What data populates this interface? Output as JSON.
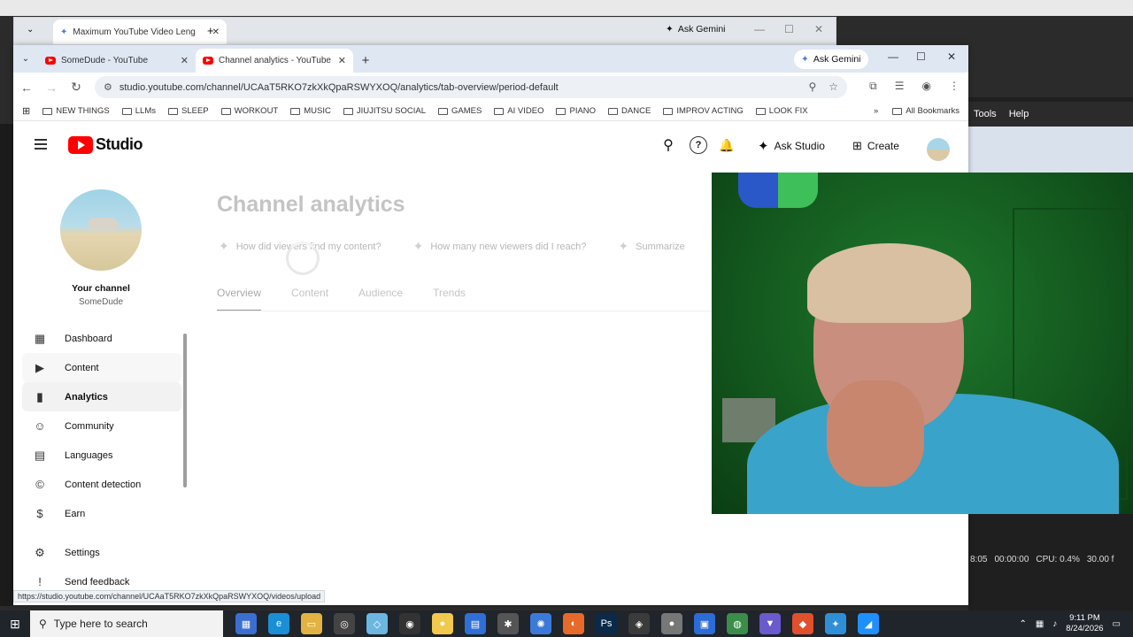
{
  "back_window": {
    "tab_title": "Maximum YouTube Video Leng",
    "gemini_label": "Ask Gemini"
  },
  "browser": {
    "tabs": [
      {
        "title": "SomeDude - YouTube",
        "active": false
      },
      {
        "title": "Channel analytics - YouTube St",
        "active": true
      }
    ],
    "gemini_label": "Ask Gemini",
    "url": "studio.youtube.com/channel/UCAaT5RKO7zkXkQpaRSWYXOQ/analytics/tab-overview/period-default",
    "bookmarks": [
      "NEW THINGS",
      "LLMs",
      "SLEEP",
      "WORKOUT",
      "MUSIC",
      "JIUJITSU SOCIAL",
      "GAMES",
      "AI VIDEO",
      "PIANO",
      "DANCE",
      "IMPROV ACTING",
      "LOOK FIX"
    ],
    "all_bookmarks": "All Bookmarks",
    "status_url": "https://studio.youtube.com/channel/UCAaT5RKO7zkXkQpaRSWYXOQ/videos/upload"
  },
  "studio": {
    "logo_text": "Studio",
    "ask_studio": "Ask Studio",
    "create": "Create",
    "channel": {
      "label": "Your channel",
      "name": "SomeDude"
    },
    "nav": [
      {
        "label": "Dashboard",
        "icon": "dashboard-icon"
      },
      {
        "label": "Content",
        "icon": "content-icon"
      },
      {
        "label": "Analytics",
        "icon": "analytics-icon"
      },
      {
        "label": "Community",
        "icon": "community-icon"
      },
      {
        "label": "Languages",
        "icon": "languages-icon"
      },
      {
        "label": "Content detection",
        "icon": "copyright-icon"
      },
      {
        "label": "Earn",
        "icon": "earn-icon"
      }
    ],
    "nav_bottom": [
      {
        "label": "Settings",
        "icon": "gear-icon"
      },
      {
        "label": "Send feedback",
        "icon": "feedback-icon"
      }
    ],
    "page_title": "Channel analytics",
    "chips": [
      "How did viewers find my content?",
      "How many new viewers did I reach?",
      "Summarize"
    ],
    "tabs": [
      "Overview",
      "Content",
      "Audience",
      "Trends"
    ]
  },
  "desktop_app": {
    "menu": [
      "Tools",
      "Help"
    ],
    "status": [
      "8:05",
      "00:00:00",
      "CPU: 0.4%",
      "30.00 f"
    ]
  },
  "taskbar": {
    "search_placeholder": "Type here to search",
    "time": "9:11 PM",
    "date": "8/24/2026"
  }
}
